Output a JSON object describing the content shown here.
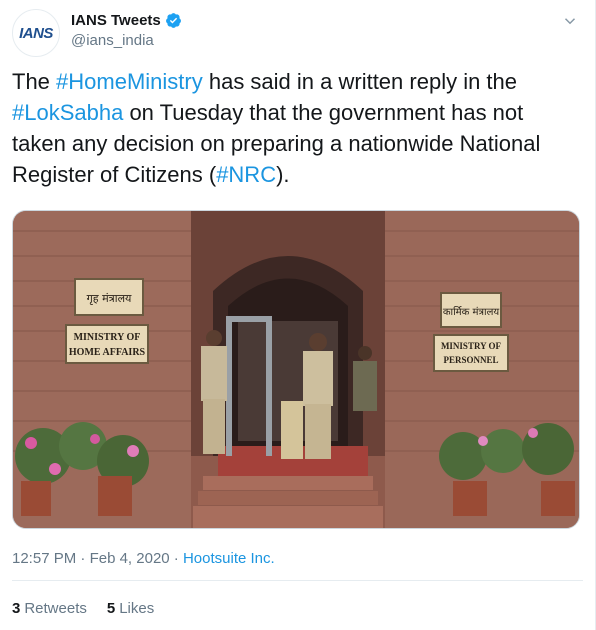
{
  "author": {
    "avatar_text": "IANS",
    "display_name": "IANS Tweets",
    "handle": "@ians_india",
    "verified": true
  },
  "tweet": {
    "segments": [
      {
        "text": "The ",
        "hashtag": false
      },
      {
        "text": "#HomeMinistry",
        "hashtag": true
      },
      {
        "text": " has said in a written reply in the ",
        "hashtag": false
      },
      {
        "text": "#LokSabha",
        "hashtag": true
      },
      {
        "text": " on Tuesday that the government has not taken any decision on preparing a nationwide National Register of Citizens (",
        "hashtag": false
      },
      {
        "text": "#NRC",
        "hashtag": true
      },
      {
        "text": ").",
        "hashtag": false
      }
    ]
  },
  "media": {
    "sign_left_hindi": "गृह मंत्रालय",
    "sign_left_line1": "MINISTRY OF",
    "sign_left_line2": "HOME AFFAIRS",
    "sign_right_hindi": "कार्मिक मंत्रालय",
    "sign_right_line1": "MINISTRY OF",
    "sign_right_line2": "PERSONNEL"
  },
  "meta": {
    "time": "12:57 PM",
    "separator": "·",
    "date": "Feb 4, 2020",
    "source": "Hootsuite Inc."
  },
  "stats": {
    "retweets_count": "3",
    "retweets_label": "Retweets",
    "likes_count": "5",
    "likes_label": "Likes"
  },
  "colors": {
    "link": "#1b95e0",
    "text": "#14171a",
    "secondary": "#657786",
    "verified": "#1da1f2"
  },
  "icons": {
    "verified": "verified-badge-icon",
    "caret": "chevron-down-icon"
  }
}
